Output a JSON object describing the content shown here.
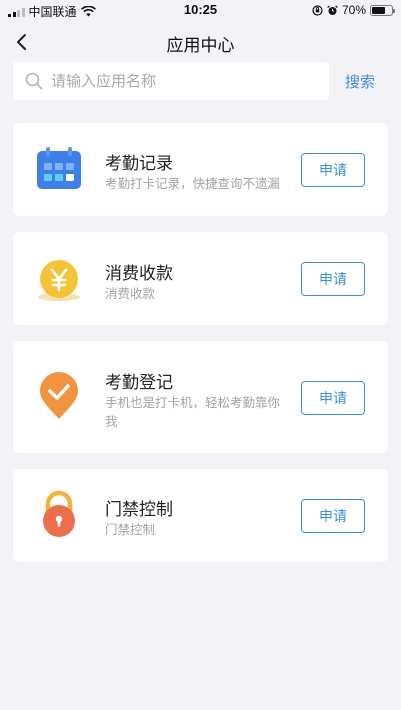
{
  "status_bar": {
    "carrier": "中国联通",
    "time": "10:25",
    "battery": "70%",
    "battery_level": 0.7
  },
  "nav": {
    "title": "应用中心",
    "back_icon": "chevron-left-icon"
  },
  "search": {
    "placeholder": "请输入应用名称",
    "value": "",
    "button_label": "搜索"
  },
  "colors": {
    "accent": "#3d8fd6",
    "background": "#f2f2f7",
    "calendar_icon": "#3f7fe8",
    "coin_icon": "#f5c338",
    "pin_icon": "#f0943f",
    "lock_icon": "#ec6f4c"
  },
  "apps": [
    {
      "title": "考勤记录",
      "desc": "考勤打卡记录，快捷查询不遗漏",
      "button": "申请",
      "icon": "calendar-icon"
    },
    {
      "title": "消费收款",
      "desc": "消费收款",
      "button": "申请",
      "icon": "yen-coin-icon"
    },
    {
      "title": "考勤登记",
      "desc": "手机也是打卡机，轻松考勤靠你我",
      "button": "申请",
      "icon": "check-pin-icon"
    },
    {
      "title": "门禁控制",
      "desc": "门禁控制",
      "button": "申请",
      "icon": "padlock-icon"
    }
  ]
}
